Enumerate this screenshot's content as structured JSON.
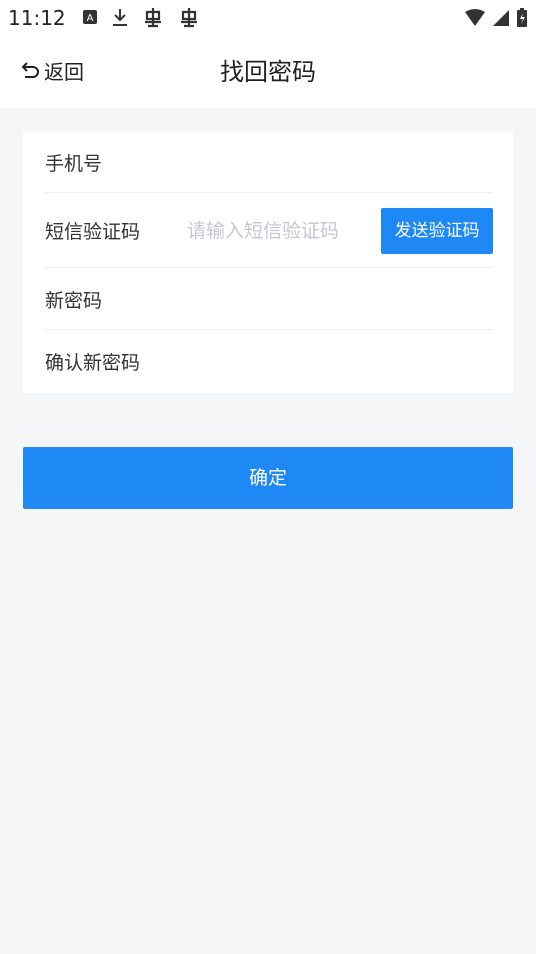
{
  "status_bar": {
    "time": "11:12",
    "left_icons": [
      "a-badge-icon",
      "download-icon",
      "bug-icon",
      "bug-icon"
    ],
    "right_icons": [
      "wifi-icon",
      "signal-icon",
      "battery-charging-icon"
    ]
  },
  "nav": {
    "back_label": "返回",
    "title": "找回密码"
  },
  "form": {
    "phone_label": "手机号",
    "sms_label": "短信验证码",
    "sms_placeholder": "请输入短信验证码",
    "send_code_label": "发送验证码",
    "new_password_label": "新密码",
    "confirm_password_label": "确认新密码"
  },
  "actions": {
    "confirm_label": "确定"
  },
  "colors": {
    "accent": "#1e88f5",
    "background": "#f5f6f8"
  }
}
